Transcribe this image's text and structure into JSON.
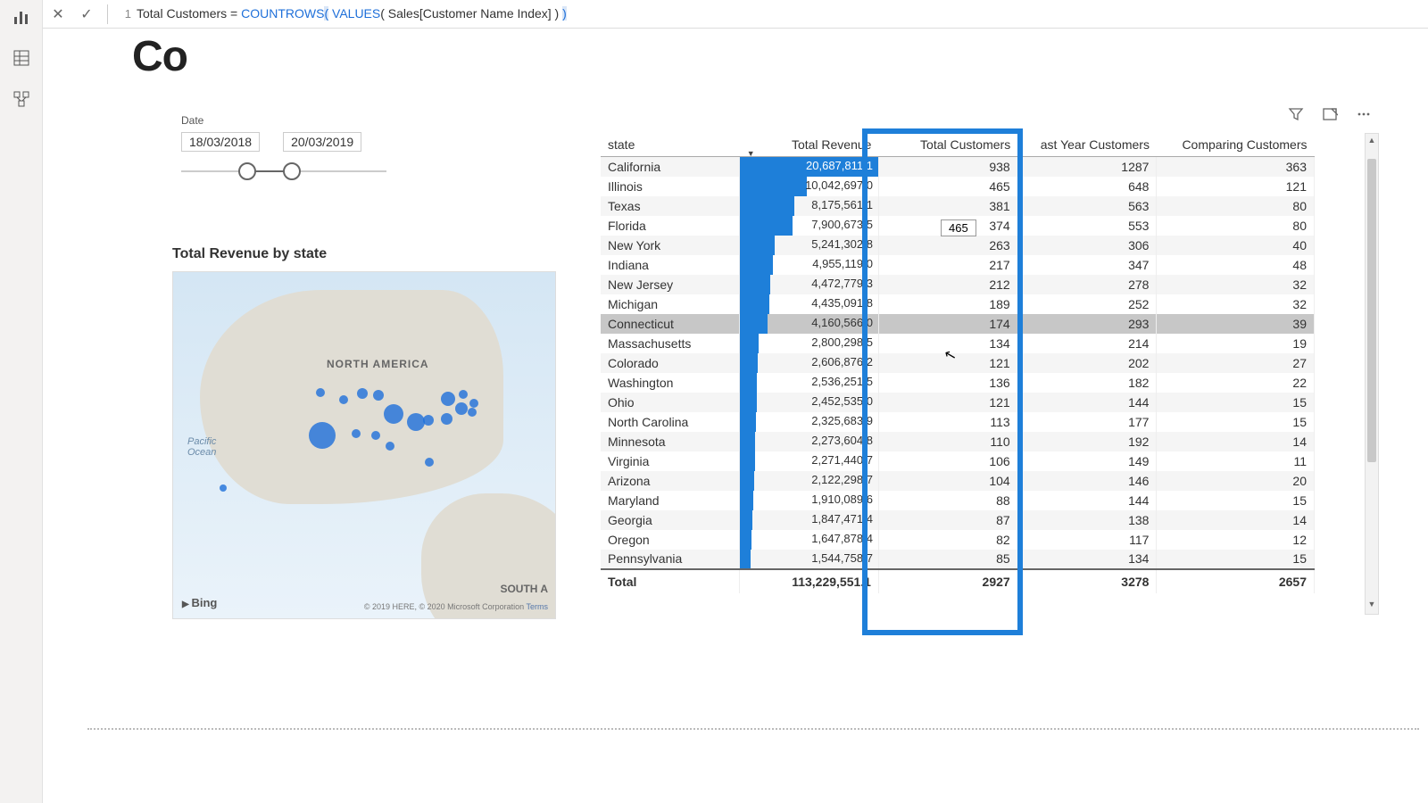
{
  "formula": {
    "line": "1",
    "measure": "Total Customers",
    "eq": " = ",
    "fn1": "COUNTROWS",
    "br_open": "(",
    "sp1": " ",
    "fn2": "VALUES",
    "br2o": "(",
    "arg": " Sales[Customer Name Index] ",
    "br2c": ")",
    "sp2": " ",
    "br_close": ")"
  },
  "title_frag": "Co",
  "slicer": {
    "label": "Date",
    "from": "18/03/2018",
    "to": "20/03/2019"
  },
  "map": {
    "title": "Total Revenue by state",
    "na": "NORTH AMERICA",
    "sa": "SOUTH A",
    "po": "Pacific\nOcean",
    "bing": "Bing",
    "cred": "© 2019 HERE, © 2020 Microsoft Corporation ",
    "terms": "Terms"
  },
  "table": {
    "headers": {
      "state": "state",
      "rev": "Total Revenue",
      "cust": "Total Customers",
      "last": "ast Year Customers",
      "comp": "Comparing Customers"
    },
    "max_rev": 20687811.1,
    "rows": [
      {
        "state": "California",
        "rev": "20,687,811.1",
        "revn": 20687811.1,
        "cust": "938",
        "last": "1287",
        "comp": "363"
      },
      {
        "state": "Illinois",
        "rev": "10,042,697.0",
        "revn": 10042697.0,
        "cust": "465",
        "last": "648",
        "comp": "121"
      },
      {
        "state": "Texas",
        "rev": "8,175,561.1",
        "revn": 8175561.1,
        "cust": "381",
        "last": "563",
        "comp": "80"
      },
      {
        "state": "Florida",
        "rev": "7,900,673.5",
        "revn": 7900673.5,
        "cust": "374",
        "last": "553",
        "comp": "80"
      },
      {
        "state": "New York",
        "rev": "5,241,302.8",
        "revn": 5241302.8,
        "cust": "263",
        "last": "306",
        "comp": "40"
      },
      {
        "state": "Indiana",
        "rev": "4,955,119.0",
        "revn": 4955119.0,
        "cust": "217",
        "last": "347",
        "comp": "48"
      },
      {
        "state": "New Jersey",
        "rev": "4,472,779.3",
        "revn": 4472779.3,
        "cust": "212",
        "last": "278",
        "comp": "32"
      },
      {
        "state": "Michigan",
        "rev": "4,435,091.8",
        "revn": 4435091.8,
        "cust": "189",
        "last": "252",
        "comp": "32"
      },
      {
        "state": "Connecticut",
        "rev": "4,160,566.0",
        "revn": 4160566.0,
        "cust": "174",
        "last": "293",
        "comp": "39",
        "hover": true
      },
      {
        "state": "Massachusetts",
        "rev": "2,800,298.5",
        "revn": 2800298.5,
        "cust": "134",
        "last": "214",
        "comp": "19"
      },
      {
        "state": "Colorado",
        "rev": "2,606,876.2",
        "revn": 2606876.2,
        "cust": "121",
        "last": "202",
        "comp": "27"
      },
      {
        "state": "Washington",
        "rev": "2,536,251.5",
        "revn": 2536251.5,
        "cust": "136",
        "last": "182",
        "comp": "22"
      },
      {
        "state": "Ohio",
        "rev": "2,452,535.0",
        "revn": 2452535.0,
        "cust": "121",
        "last": "144",
        "comp": "15"
      },
      {
        "state": "North Carolina",
        "rev": "2,325,683.9",
        "revn": 2325683.9,
        "cust": "113",
        "last": "177",
        "comp": "15"
      },
      {
        "state": "Minnesota",
        "rev": "2,273,604.8",
        "revn": 2273604.8,
        "cust": "110",
        "last": "192",
        "comp": "14"
      },
      {
        "state": "Virginia",
        "rev": "2,271,440.7",
        "revn": 2271440.7,
        "cust": "106",
        "last": "149",
        "comp": "11"
      },
      {
        "state": "Arizona",
        "rev": "2,122,298.7",
        "revn": 2122298.7,
        "cust": "104",
        "last": "146",
        "comp": "20"
      },
      {
        "state": "Maryland",
        "rev": "1,910,089.6",
        "revn": 1910089.6,
        "cust": "88",
        "last": "144",
        "comp": "15"
      },
      {
        "state": "Georgia",
        "rev": "1,847,471.4",
        "revn": 1847471.4,
        "cust": "87",
        "last": "138",
        "comp": "14"
      },
      {
        "state": "Oregon",
        "rev": "1,647,878.4",
        "revn": 1647878.4,
        "cust": "82",
        "last": "117",
        "comp": "12"
      },
      {
        "state": "Pennsylvania",
        "rev": "1,544,758.7",
        "revn": 1544758.7,
        "cust": "85",
        "last": "134",
        "comp": "15"
      }
    ],
    "total": {
      "label": "Total",
      "rev": "113,229,551.1",
      "cust": "2927",
      "last": "3278",
      "comp": "2657"
    }
  },
  "tooltip": "465"
}
